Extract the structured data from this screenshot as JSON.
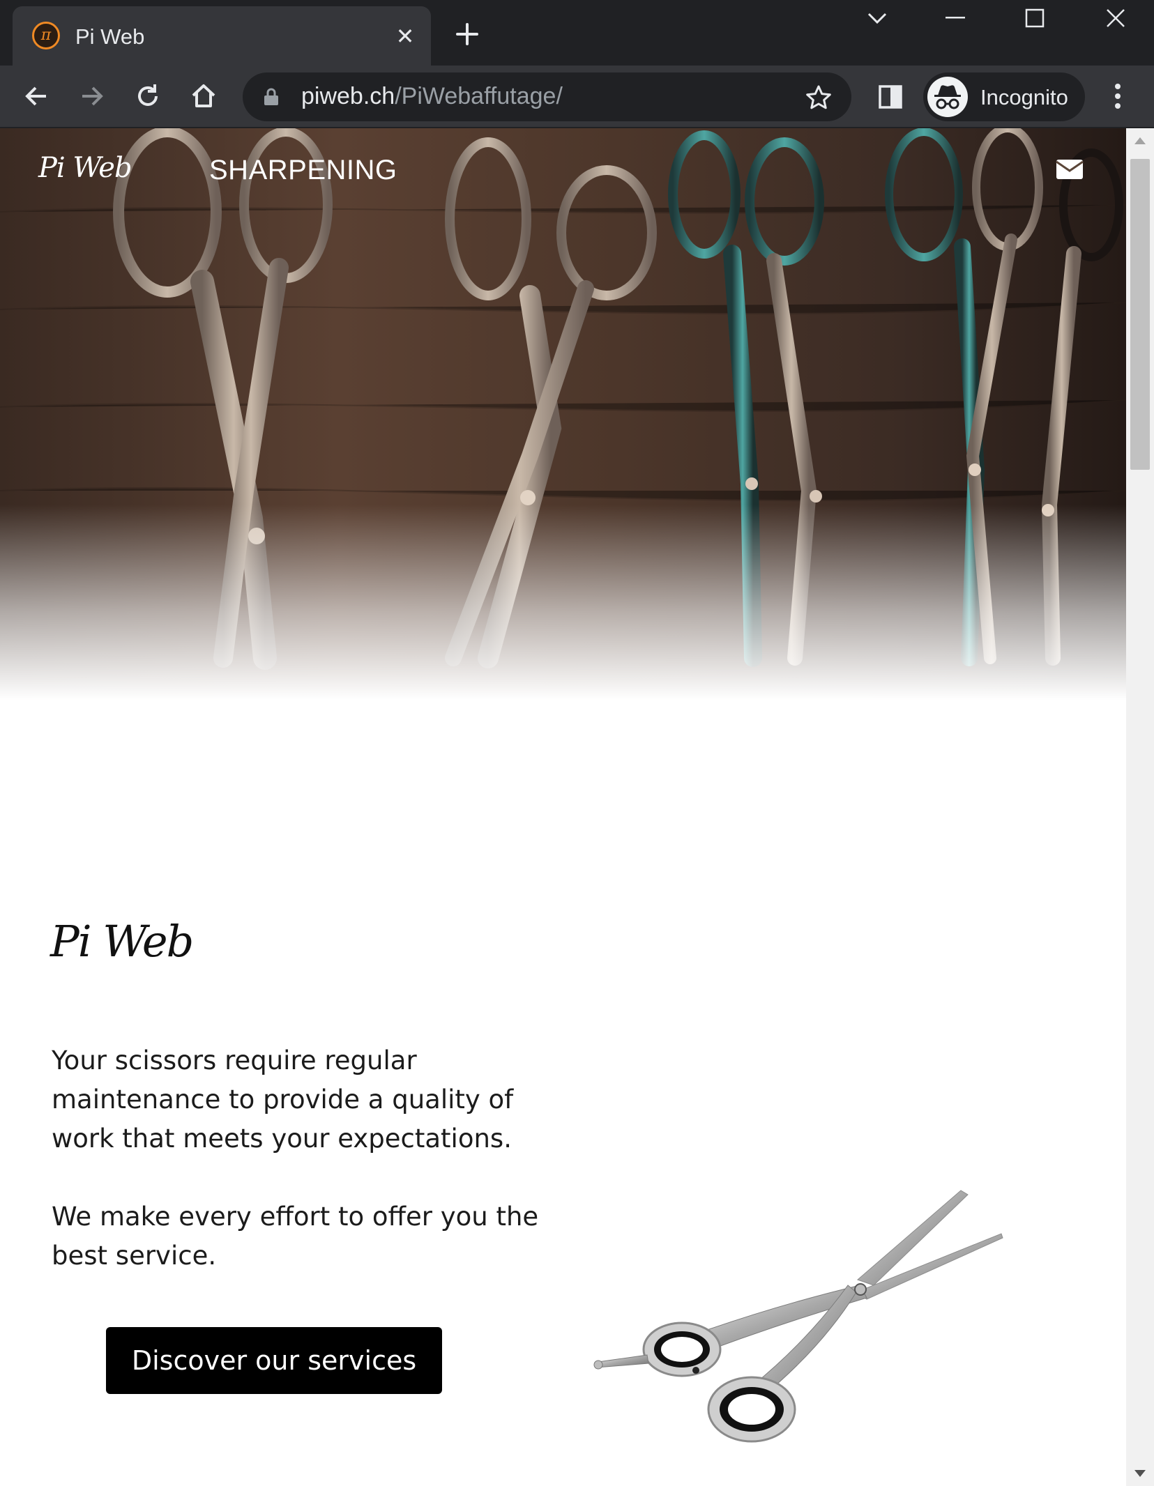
{
  "browser": {
    "tab_title": "Pi Web",
    "url_host": "piweb.ch",
    "url_path": "/PiWebaffutage/",
    "profile_label": "Incognito",
    "favicon_glyph": "π"
  },
  "nav": {
    "logo": "Pi Web",
    "link": "SHARPENING",
    "contact_icon": "envelope-icon"
  },
  "content": {
    "brand": "Pi Web",
    "paragraphs": [
      "Your scissors require regular maintenance to provide a quality of work that meets your expectations.",
      "We make every effort to offer you the best service."
    ],
    "cta_label": "Discover our services"
  },
  "colors": {
    "chrome_dark": "#202124",
    "chrome_tab": "#35363a",
    "cta_bg": "#000000",
    "favicon_accent": "#f08a24"
  }
}
